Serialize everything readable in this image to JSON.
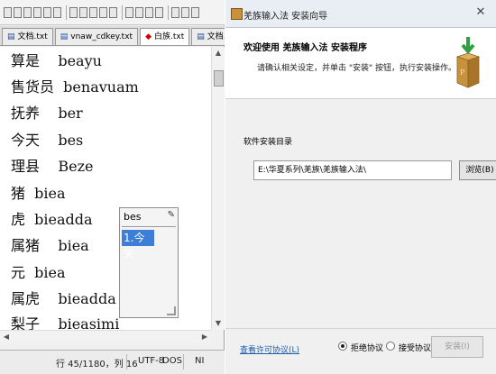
{
  "editor": {
    "tabs": [
      {
        "label": "文档.txt",
        "active": false,
        "modified": false
      },
      {
        "label": "vnaw_cdkey.txt",
        "active": false,
        "modified": false
      },
      {
        "label": "白族.txt",
        "active": true,
        "modified": true
      },
      {
        "label": "文档.txt",
        "active": false,
        "modified": false
      }
    ],
    "lines": [
      "算是    beayu",
      "售货员  benavuam",
      "抚养    ber",
      "今天    bes",
      "理县    Beze",
      "猪  biea",
      "虎  bieadda",
      "属猪    biea",
      "元  biea",
      "属虎    bieadda",
      "梨子    bieasimi"
    ],
    "status": {
      "position": "行 45/1180，列 16",
      "encoding": "UTF-8",
      "line_ending": "DOS",
      "mode": "NI"
    }
  },
  "ime": {
    "composition": "bes",
    "candidate": "1.今天"
  },
  "installer": {
    "title": "羌族输入法 安装向导",
    "heading": "欢迎使用  羌族输入法  安装程序",
    "subheading": "请确认相关设定，并单击 \"安装\" 按钮，执行安装操作。",
    "dir_label": "软件安装目录",
    "dir_value": "E:\\华夏系列\\羌族\\羌族输入法\\",
    "browse_label": "浏览(B)",
    "license_link": "查看许可协议(L)",
    "reject_label": "拒绝协议",
    "accept_label": "接受协议",
    "install_label": "安装(I)",
    "reject_selected": true
  }
}
